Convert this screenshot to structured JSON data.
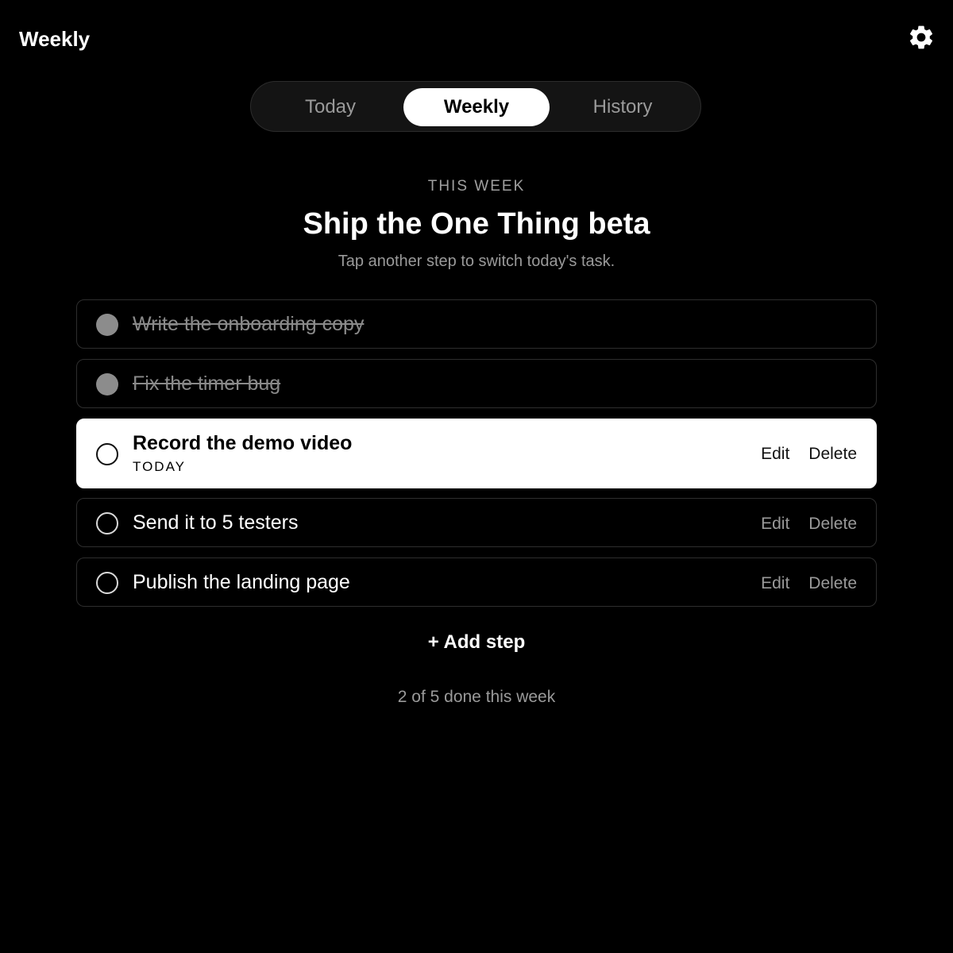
{
  "header": {
    "title": "Weekly",
    "settings_icon": "gear-icon"
  },
  "tabs": [
    {
      "label": "Today",
      "active": false
    },
    {
      "label": "Weekly",
      "active": true
    },
    {
      "label": "History",
      "active": false
    }
  ],
  "week": {
    "eyebrow": "THIS WEEK",
    "goal": "Ship the One Thing beta",
    "hint": "Tap another step to switch today's task."
  },
  "steps": [
    {
      "label": "Write the onboarding copy",
      "status": "done"
    },
    {
      "label": "Fix the timer bug",
      "status": "done"
    },
    {
      "label": "Record the demo video",
      "status": "current",
      "tag": "TODAY",
      "edit_label": "Edit",
      "delete_label": "Delete"
    },
    {
      "label": "Send it to 5 testers",
      "status": "todo",
      "edit_label": "Edit",
      "delete_label": "Delete"
    },
    {
      "label": "Publish the landing page",
      "status": "todo",
      "edit_label": "Edit",
      "delete_label": "Delete"
    }
  ],
  "add_step_label": "+ Add step",
  "progress_text": "2 of 5 done this week",
  "colors": {
    "background": "#000000",
    "active": "#ffffff",
    "muted": "#9a9a9a",
    "done_dot": "#8c8c8c"
  }
}
